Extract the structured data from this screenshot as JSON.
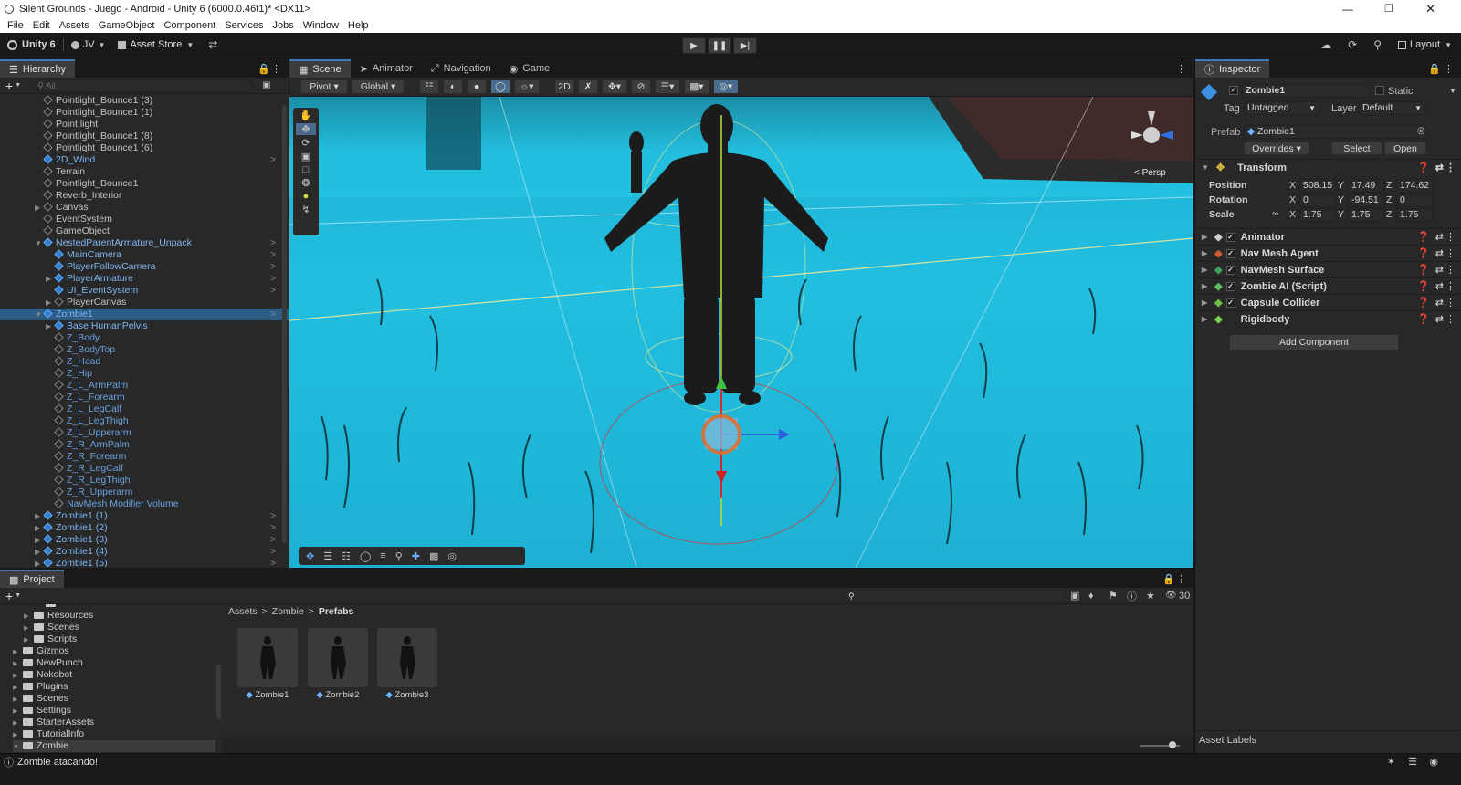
{
  "window": {
    "title": "Silent Grounds - Juego - Android - Unity 6 (6000.0.46f1)* <DX11>"
  },
  "menu": [
    "File",
    "Edit",
    "Assets",
    "GameObject",
    "Component",
    "Services",
    "Jobs",
    "Window",
    "Help"
  ],
  "toolbar": {
    "unity_label": "Unity 6",
    "account": "JV",
    "asset_store": "Asset Store",
    "layout": "Layout"
  },
  "hierarchy": {
    "tab": "Hierarchy",
    "search_placeholder": "All",
    "items": [
      {
        "label": "Pointlight_Bounce1 (3)",
        "indent": 1
      },
      {
        "label": "Pointlight_Bounce1 (1)",
        "indent": 1
      },
      {
        "label": "Point light",
        "indent": 1
      },
      {
        "label": "Pointlight_Bounce1 (8)",
        "indent": 1
      },
      {
        "label": "Pointlight_Bounce1 (6)",
        "indent": 1
      },
      {
        "label": "2D_Wind",
        "indent": 1,
        "prefab": true
      },
      {
        "label": "Terrain",
        "indent": 1
      },
      {
        "label": "Pointlight_Bounce1",
        "indent": 1
      },
      {
        "label": "Reverb_Interior",
        "indent": 1
      },
      {
        "label": "Canvas",
        "indent": 1
      },
      {
        "label": "EventSystem",
        "indent": 1
      },
      {
        "label": "GameObject",
        "indent": 1
      },
      {
        "label": "NestedParentArmature_Unpack",
        "indent": 1,
        "prefab": true
      },
      {
        "label": "MainCamera",
        "indent": 2,
        "prefab": true
      },
      {
        "label": "PlayerFollowCamera",
        "indent": 2,
        "prefab": true
      },
      {
        "label": "PlayerArmature",
        "indent": 2,
        "prefab": true
      },
      {
        "label": "UI_EventSystem",
        "indent": 2,
        "prefab": true
      },
      {
        "label": "PlayerCanvas",
        "indent": 2
      },
      {
        "label": "Zombie1",
        "indent": 1,
        "prefab": true,
        "selected": true
      },
      {
        "label": "Base HumanPelvis",
        "indent": 2,
        "prefab": true
      },
      {
        "label": "Z_Body",
        "indent": 2,
        "muted": true
      },
      {
        "label": "Z_BodyTop",
        "indent": 2,
        "muted": true
      },
      {
        "label": "Z_Head",
        "indent": 2,
        "muted": true
      },
      {
        "label": "Z_Hip",
        "indent": 2,
        "muted": true
      },
      {
        "label": "Z_L_ArmPalm",
        "indent": 2,
        "muted": true
      },
      {
        "label": "Z_L_Forearm",
        "indent": 2,
        "muted": true
      },
      {
        "label": "Z_L_LegCalf",
        "indent": 2,
        "muted": true
      },
      {
        "label": "Z_L_LegThigh",
        "indent": 2,
        "muted": true
      },
      {
        "label": "Z_L_Upperarm",
        "indent": 2,
        "muted": true
      },
      {
        "label": "Z_R_ArmPalm",
        "indent": 2,
        "muted": true
      },
      {
        "label": "Z_R_Forearm",
        "indent": 2,
        "muted": true
      },
      {
        "label": "Z_R_LegCalf",
        "indent": 2,
        "muted": true
      },
      {
        "label": "Z_R_LegThigh",
        "indent": 2,
        "muted": true
      },
      {
        "label": "Z_R_Upperarm",
        "indent": 2,
        "muted": true
      },
      {
        "label": "NavMesh Modifier Volume",
        "indent": 2,
        "muted": true
      },
      {
        "label": "Zombie1 (1)",
        "indent": 1,
        "prefab": true
      },
      {
        "label": "Zombie1 (2)",
        "indent": 1,
        "prefab": true
      },
      {
        "label": "Zombie1 (3)",
        "indent": 1,
        "prefab": true
      },
      {
        "label": "Zombie1 (4)",
        "indent": 1,
        "prefab": true
      },
      {
        "label": "Zombie1 (5)",
        "indent": 1,
        "prefab": true
      }
    ]
  },
  "scene_tabs": [
    "Scene",
    "Animator",
    "Navigation",
    "Game"
  ],
  "scene_toolbar": {
    "pivot": "Pivot",
    "global": "Global",
    "persp": "< Persp"
  },
  "inspector": {
    "tab": "Inspector",
    "object_name": "Zombie1",
    "static_label": "Static",
    "tag_label": "Tag",
    "tag_value": "Untagged",
    "layer_label": "Layer",
    "layer_value": "Default",
    "prefab_label": "Prefab",
    "prefab_value": "Zombie1",
    "overrides": "Overrides",
    "select": "Select",
    "open": "Open",
    "transform": {
      "title": "Transform",
      "position_label": "Position",
      "rotation_label": "Rotation",
      "scale_label": "Scale",
      "position": {
        "x": "508.15",
        "y": "17.49",
        "z": "174.62"
      },
      "rotation": {
        "x": "0",
        "y": "-94.51",
        "z": "0"
      },
      "scale": {
        "x": "1.75",
        "y": "1.75",
        "z": "1.75"
      },
      "axis_x": "X",
      "axis_y": "Y",
      "axis_z": "Z"
    },
    "components": [
      "Animator",
      "Nav Mesh Agent",
      "NavMesh Surface",
      "Zombie AI (Script)",
      "Capsule Collider",
      "Rigidbody"
    ],
    "add_component": "Add Component",
    "asset_labels": "Asset Labels"
  },
  "project": {
    "tab": "Project",
    "tree": [
      {
        "label": "Resources",
        "indent": 2
      },
      {
        "label": "Scenes",
        "indent": 2
      },
      {
        "label": "Scripts",
        "indent": 2
      },
      {
        "label": "Gizmos",
        "indent": 1
      },
      {
        "label": "NewPunch",
        "indent": 1
      },
      {
        "label": "Nokobot",
        "indent": 1
      },
      {
        "label": "Plugins",
        "indent": 1
      },
      {
        "label": "Scenes",
        "indent": 1
      },
      {
        "label": "Settings",
        "indent": 1
      },
      {
        "label": "StarterAssets",
        "indent": 1
      },
      {
        "label": "TutorialInfo",
        "indent": 1
      },
      {
        "label": "Zombie",
        "indent": 1,
        "open": true
      }
    ],
    "breadcrumb": [
      "Assets",
      "Zombie",
      "Prefabs"
    ],
    "assets": [
      "Zombie1",
      "Zombie2",
      "Zombie3"
    ],
    "hidden_count": "30"
  },
  "status": {
    "message": "Zombie atacando!"
  }
}
